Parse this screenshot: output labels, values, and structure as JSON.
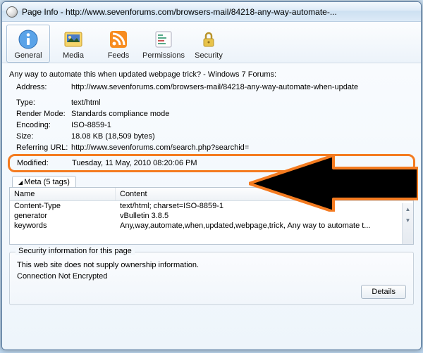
{
  "window": {
    "title": "Page Info - http://www.sevenforums.com/browsers-mail/84218-any-way-automate-..."
  },
  "toolbar": {
    "general": "General",
    "media": "Media",
    "feeds": "Feeds",
    "permissions": "Permissions",
    "security": "Security"
  },
  "page": {
    "heading": "Any way to automate this when updated webpage trick? - Windows 7 Forums:",
    "address_label": "Address:",
    "address": "http://www.sevenforums.com/browsers-mail/84218-any-way-automate-when-update",
    "type_label": "Type:",
    "type": "text/html",
    "render_label": "Render Mode:",
    "render": "Standards compliance mode",
    "encoding_label": "Encoding:",
    "encoding": "ISO-8859-1",
    "size_label": "Size:",
    "size": "18.08 KB (18,509 bytes)",
    "ref_label": "Referring URL:",
    "ref": "http://www.sevenforums.com/search.php?searchid=",
    "modified_label": "Modified:",
    "modified": "Tuesday, 11 May, 2010 08:20:06 PM"
  },
  "meta": {
    "tab_label": "Meta (5 tags)",
    "col_name": "Name",
    "col_content": "Content",
    "rows": [
      {
        "name": "Content-Type",
        "content": "text/html; charset=ISO-8859-1"
      },
      {
        "name": "generator",
        "content": "vBulletin 3.8.5"
      },
      {
        "name": "keywords",
        "content": "Any,way,automate,when,updated,webpage,trick, Any way to automate t..."
      }
    ]
  },
  "security": {
    "legend": "Security information for this page",
    "line1": "This web site does not supply ownership information.",
    "line2": "Connection Not Encrypted",
    "details": "Details"
  }
}
